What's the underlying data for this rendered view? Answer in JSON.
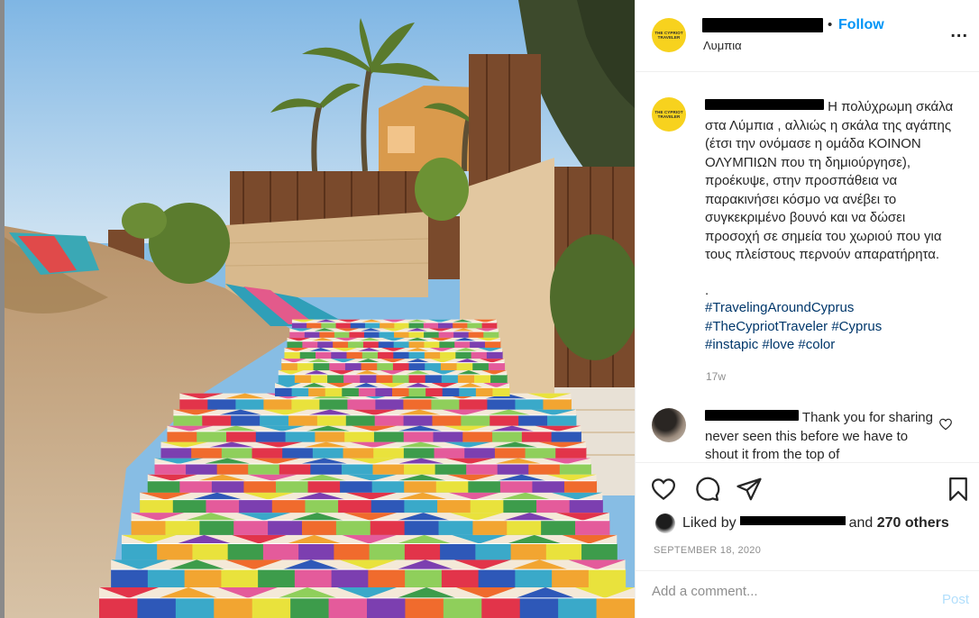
{
  "header": {
    "location": "Λυμπια",
    "follow_label": "Follow",
    "dot": "•",
    "more_label": "..."
  },
  "brand": {
    "logo_line1": "THE CYPRIOT",
    "logo_line2": "TRAVELER",
    "avatar_color": "#f7d21e"
  },
  "caption": {
    "text": "Η πολύχρωμη σκάλα στα Λύμπια , αλλιώς η σκάλα της αγάπης (έτσι την ονόμασε η ομάδα ΚΟΙΝΟΝ ΟΛΥΜΠΙΩΝ που τη δημιούργησε), προέκυψε, στην προσπάθεια να παρακινήσει κόσμο να ανέβει το συγκεκριμένο βουνό και να δώσει προσοχή σε σημεία του χωριού που για τους πλείστους περνούν απαρατήρητα.",
    "separator": ".",
    "hashtags": [
      "#TravelingAroundCyprus",
      "#TheCypriotTraveler",
      "#Cyprus",
      "#instapic",
      "#love",
      "#color"
    ],
    "age": "17w"
  },
  "reply": {
    "text": "Thank you for sharing never seen this before we have to shout it from the top of"
  },
  "actions": {
    "liked_by_prefix": "Liked by",
    "liked_by_suffix_and": "and",
    "liked_by_others": "270 others",
    "date": "SEPTEMBER 18, 2020"
  },
  "comment_box": {
    "placeholder": "Add a comment...",
    "post_label": "Post"
  },
  "colors": {
    "link": "#0095f6",
    "hashtag": "#00376b",
    "muted": "#8e8e8e",
    "post_disabled": "#b2dffc"
  }
}
